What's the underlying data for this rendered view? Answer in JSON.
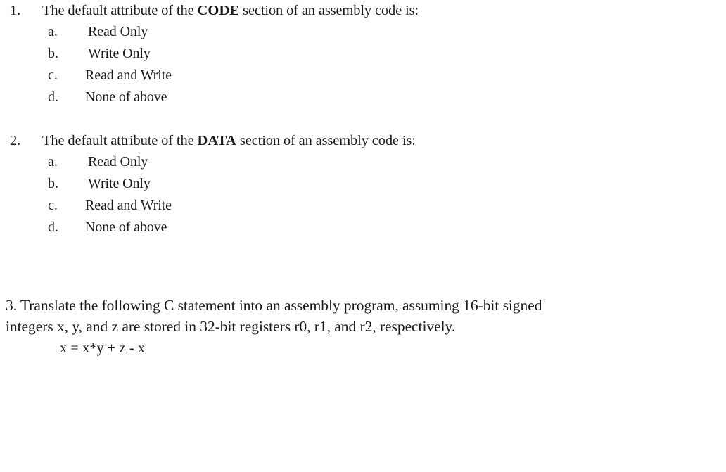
{
  "document": {
    "background_color": "#ffffff",
    "text_color": "#1b1b1b"
  },
  "questions": [
    {
      "number": "1.",
      "stem_before": "The default attribute of the ",
      "stem_emphasis": "CODE",
      "stem_after": " section of an assembly code is:",
      "options": [
        {
          "letter": "a.",
          "text": "Read Only"
        },
        {
          "letter": "b.",
          "text": "Write Only"
        },
        {
          "letter": "c.",
          "text": "Read and Write"
        },
        {
          "letter": "d.",
          "text": "None of above"
        }
      ]
    },
    {
      "number": "2.",
      "stem_before": "The default attribute of the ",
      "stem_emphasis": "DATA",
      "stem_after": " section of an assembly code is:",
      "options": [
        {
          "letter": "a.",
          "text": "Read Only"
        },
        {
          "letter": "b.",
          "text": "Write Only"
        },
        {
          "letter": "c.",
          "text": "Read and Write"
        },
        {
          "letter": "d.",
          "text": "None of above"
        }
      ]
    }
  ],
  "question3": {
    "line1": "3. Translate the following C statement into an assembly program, assuming 16-bit signed",
    "line2": "integers x, y, and z are stored in 32-bit registers r0, r1, and r2, respectively.",
    "formula": "x = x*y + z - x"
  }
}
